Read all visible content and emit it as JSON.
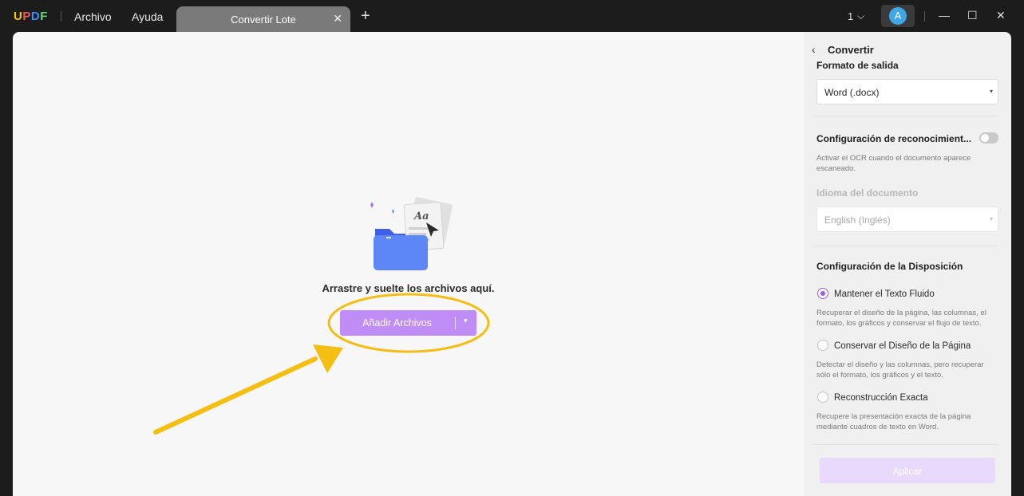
{
  "app": {
    "logo": [
      "U",
      "P",
      "D",
      "F"
    ],
    "logo_colors": [
      "#f5c400",
      "#f25a5a",
      "#3d8bff",
      "#6ad86a"
    ],
    "menu": {
      "file": "Archivo",
      "help": "Ayuda"
    },
    "tab": {
      "label": "Convertir Lote",
      "close": "✕"
    },
    "tab_add": "+",
    "page_count": "1",
    "page_chevron": "⌵",
    "avatar_letter": "A",
    "window": {
      "minimize": "—",
      "maximize": "☐",
      "close": "✕"
    }
  },
  "main": {
    "drop_text": "Arrastre y suelte los archivos aquí.",
    "add_button": "Añadir Archivos",
    "add_caret": "▾",
    "illustration_text": "Aa"
  },
  "panel": {
    "back": "‹",
    "title": "Convertir",
    "output_format_label": "Formato de salida",
    "output_format_value": "Word (.docx)",
    "ocr_label": "Configuración de reconocimient...",
    "ocr_enabled": false,
    "ocr_desc": "Activar el OCR cuando el documento aparece escaneado.",
    "doc_lang_label": "Idioma del documento",
    "doc_lang_value": "English (Inglés)",
    "layout_label": "Configuración de la Disposición",
    "options": [
      {
        "label": "Mantener el Texto Fluido",
        "desc": "Recuperar el diseño de la página, las columnas, el formato, los gráficos y conservar el flujo de texto.",
        "selected": true
      },
      {
        "label": "Conservar el Diseño de la Página",
        "desc": "Detectar el diseño y las columnas, pero recuperar sólo el formato, los gráficos y el texto.",
        "selected": false
      },
      {
        "label": "Reconstrucción Exacta",
        "desc": "Recupere la presentación exacta de la página mediante cuadros de texto en Word.",
        "selected": false
      }
    ],
    "caret": "▾",
    "apply": "Aplicar"
  },
  "colors": {
    "accent": "#c08cf6",
    "annotation": "#f5be12",
    "radio_on": "#9b5bf0"
  }
}
